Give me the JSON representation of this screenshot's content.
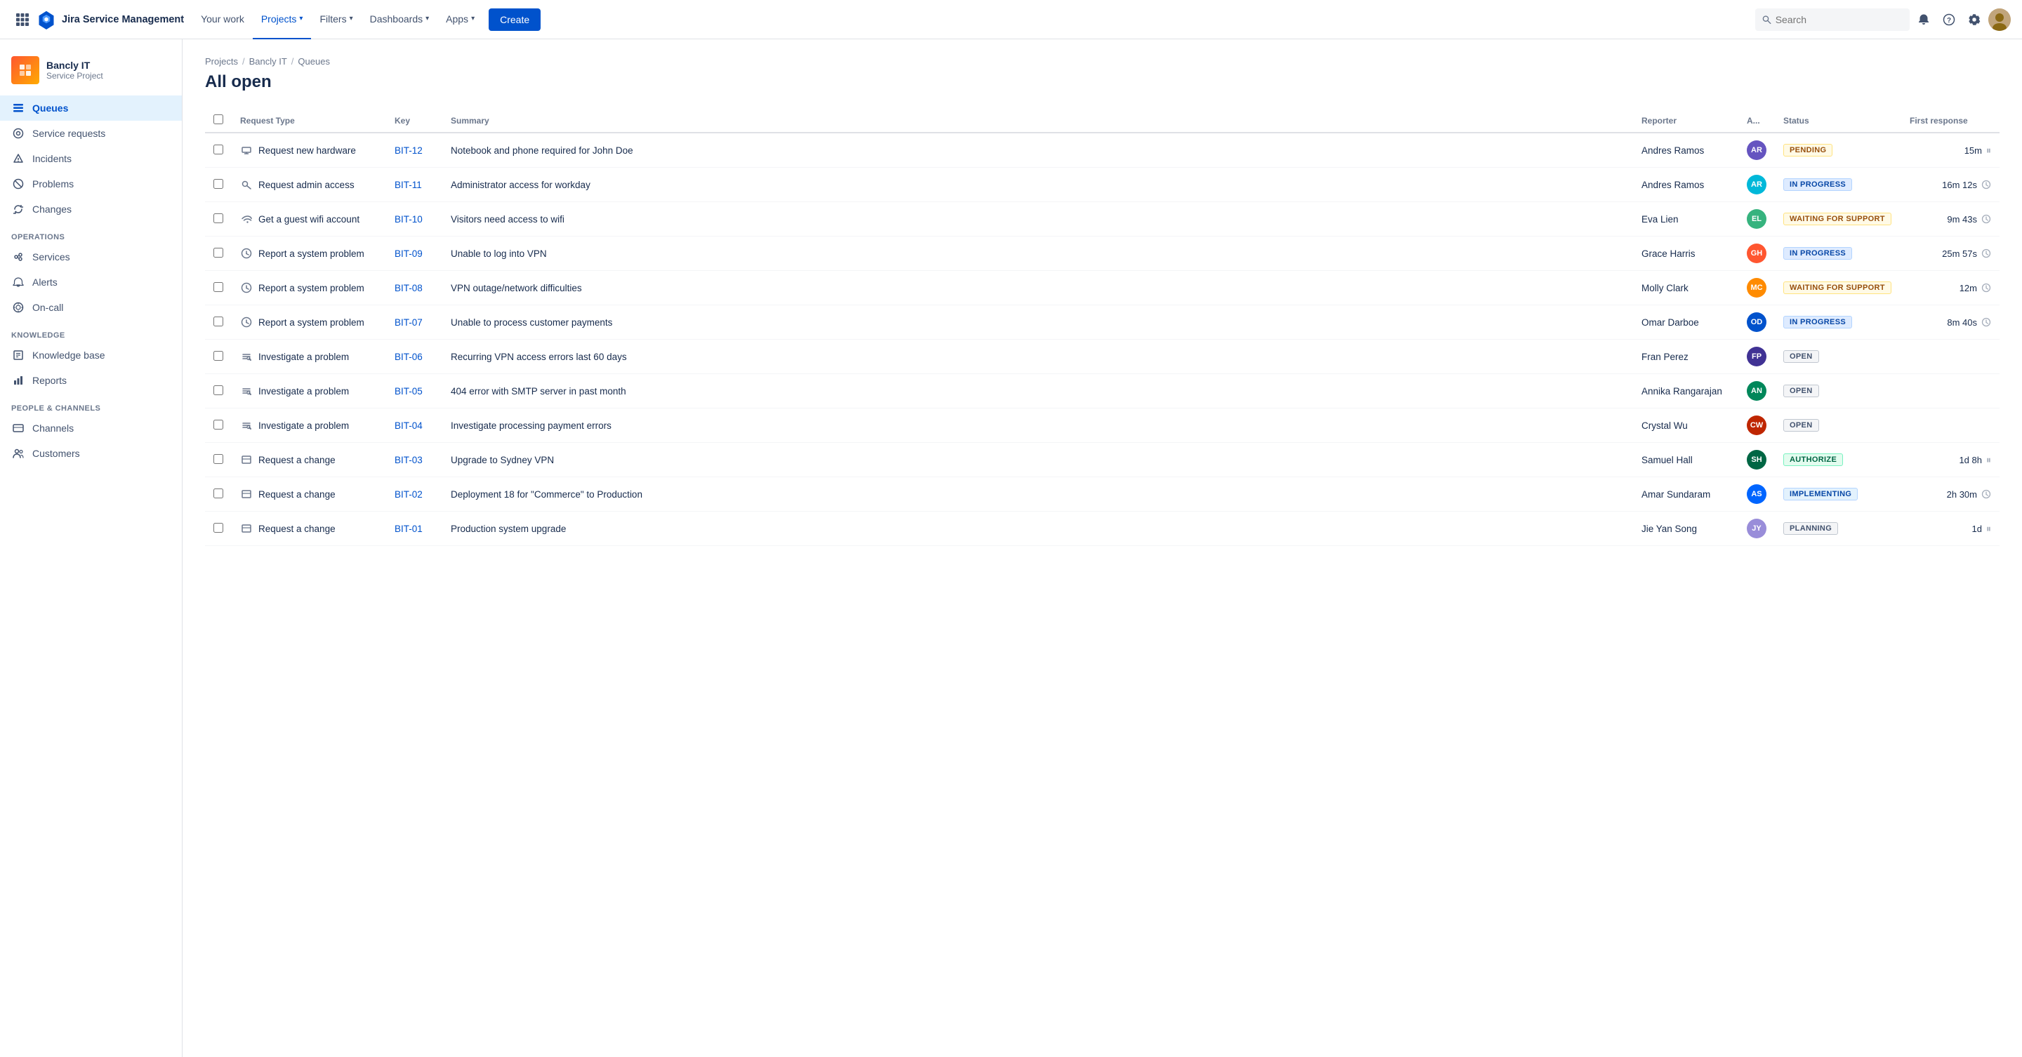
{
  "app": {
    "logo_text": "Jira Service Management"
  },
  "topnav": {
    "your_work": "Your work",
    "projects": "Projects",
    "filters": "Filters",
    "dashboards": "Dashboards",
    "apps": "Apps",
    "create": "Create",
    "search_placeholder": "Search"
  },
  "sidebar": {
    "project_name": "Bancly IT",
    "project_type": "Service Project",
    "nav_items": [
      {
        "id": "queues",
        "label": "Queues",
        "active": true
      },
      {
        "id": "service-requests",
        "label": "Service requests",
        "active": false
      },
      {
        "id": "incidents",
        "label": "Incidents",
        "active": false
      },
      {
        "id": "problems",
        "label": "Problems",
        "active": false
      },
      {
        "id": "changes",
        "label": "Changes",
        "active": false
      }
    ],
    "operations_label": "OPERATIONS",
    "operations_items": [
      {
        "id": "services",
        "label": "Services"
      },
      {
        "id": "alerts",
        "label": "Alerts"
      },
      {
        "id": "on-call",
        "label": "On-call"
      }
    ],
    "knowledge_label": "KNOWLEDGE",
    "knowledge_items": [
      {
        "id": "knowledge-base",
        "label": "Knowledge base"
      },
      {
        "id": "reports",
        "label": "Reports"
      }
    ],
    "people_label": "PEOPLE & CHANNELS",
    "people_items": [
      {
        "id": "channels",
        "label": "Channels"
      },
      {
        "id": "customers",
        "label": "Customers"
      }
    ]
  },
  "breadcrumb": {
    "projects": "Projects",
    "bancly_it": "Bancly IT",
    "queues": "Queues"
  },
  "page_title": "All open",
  "table": {
    "columns": [
      {
        "id": "request_type",
        "label": "Request Type"
      },
      {
        "id": "key",
        "label": "Key"
      },
      {
        "id": "summary",
        "label": "Summary"
      },
      {
        "id": "reporter",
        "label": "Reporter"
      },
      {
        "id": "assignee",
        "label": "A..."
      },
      {
        "id": "status",
        "label": "Status"
      },
      {
        "id": "first_response",
        "label": "First response"
      }
    ],
    "rows": [
      {
        "id": 1,
        "request_type": "Request new hardware",
        "request_icon": "hardware",
        "key": "BIT-12",
        "summary": "Notebook and phone required for John Doe",
        "reporter": "Andres Ramos",
        "assignee_initials": "AR",
        "assignee_color": "av-1",
        "status": "PENDING",
        "status_class": "status-pending",
        "first_response": "15m",
        "has_pause": true,
        "has_clock": false
      },
      {
        "id": 2,
        "request_type": "Request admin access",
        "request_icon": "key",
        "key": "BIT-11",
        "summary": "Administrator access for workday",
        "reporter": "Andres Ramos",
        "assignee_initials": "AR",
        "assignee_color": "av-2",
        "status": "IN PROGRESS",
        "status_class": "status-inprogress",
        "first_response": "16m 12s",
        "has_pause": false,
        "has_clock": true
      },
      {
        "id": 3,
        "request_type": "Get a guest wifi account",
        "request_icon": "wifi",
        "key": "BIT-10",
        "summary": "Visitors need access to wifi",
        "reporter": "Eva Lien",
        "assignee_initials": "EL",
        "assignee_color": "av-3",
        "status": "WAITING FOR SUPPORT",
        "status_class": "status-waiting",
        "first_response": "9m 43s",
        "has_pause": false,
        "has_clock": true
      },
      {
        "id": 4,
        "request_type": "Report a system problem",
        "request_icon": "clock",
        "key": "BIT-09",
        "summary": "Unable to log into VPN",
        "reporter": "Grace Harris",
        "assignee_initials": "GH",
        "assignee_color": "av-4",
        "status": "IN PROGRESS",
        "status_class": "status-inprogress",
        "first_response": "25m 57s",
        "has_pause": false,
        "has_clock": true
      },
      {
        "id": 5,
        "request_type": "Report a system problem",
        "request_icon": "clock",
        "key": "BIT-08",
        "summary": "VPN outage/network difficulties",
        "reporter": "Molly Clark",
        "assignee_initials": "MC",
        "assignee_color": "av-5",
        "status": "WAITING FOR SUPPORT",
        "status_class": "status-waiting",
        "first_response": "12m",
        "has_pause": false,
        "has_clock": true
      },
      {
        "id": 6,
        "request_type": "Report a system problem",
        "request_icon": "clock",
        "key": "BIT-07",
        "summary": "Unable to process customer payments",
        "reporter": "Omar Darboe",
        "assignee_initials": "OD",
        "assignee_color": "av-6",
        "status": "IN PROGRESS",
        "status_class": "status-inprogress",
        "first_response": "8m 40s",
        "has_pause": false,
        "has_clock": true
      },
      {
        "id": 7,
        "request_type": "Investigate a problem",
        "request_icon": "investigate",
        "key": "BIT-06",
        "summary": "Recurring VPN access errors last 60 days",
        "reporter": "Fran Perez",
        "assignee_initials": "FP",
        "assignee_color": "av-7",
        "status": "OPEN",
        "status_class": "status-open",
        "first_response": "",
        "has_pause": false,
        "has_clock": false
      },
      {
        "id": 8,
        "request_type": "Investigate a problem",
        "request_icon": "investigate",
        "key": "BIT-05",
        "summary": "404 error with SMTP server in past month",
        "reporter": "Annika Rangarajan",
        "assignee_initials": "AN",
        "assignee_color": "av-8",
        "status": "OPEN",
        "status_class": "status-open",
        "first_response": "",
        "has_pause": false,
        "has_clock": false
      },
      {
        "id": 9,
        "request_type": "Investigate a problem",
        "request_icon": "investigate",
        "key": "BIT-04",
        "summary": "Investigate processing payment errors",
        "reporter": "Crystal Wu",
        "assignee_initials": "CW",
        "assignee_color": "av-9",
        "status": "OPEN",
        "status_class": "status-open",
        "first_response": "",
        "has_pause": false,
        "has_clock": false
      },
      {
        "id": 10,
        "request_type": "Request a change",
        "request_icon": "change",
        "key": "BIT-03",
        "summary": "Upgrade to Sydney VPN",
        "reporter": "Samuel Hall",
        "assignee_initials": "SH",
        "assignee_color": "av-10",
        "status": "AUTHORIZE",
        "status_class": "status-authorize",
        "first_response": "1d 8h",
        "has_pause": true,
        "has_clock": false
      },
      {
        "id": 11,
        "request_type": "Request a change",
        "request_icon": "change",
        "key": "BIT-02",
        "summary": "Deployment 18 for \"Commerce\" to Production",
        "reporter": "Amar Sundaram",
        "assignee_initials": "AS",
        "assignee_color": "av-11",
        "status": "IMPLEMENTING",
        "status_class": "status-implementing",
        "first_response": "2h 30m",
        "has_pause": false,
        "has_clock": true
      },
      {
        "id": 12,
        "request_type": "Request a change",
        "request_icon": "change",
        "key": "BIT-01",
        "summary": "Production system upgrade",
        "reporter": "Jie Yan Song",
        "assignee_initials": "JY",
        "assignee_color": "av-12",
        "status": "PLANNING",
        "status_class": "status-planning",
        "first_response": "1d",
        "has_pause": true,
        "has_clock": false
      }
    ]
  }
}
